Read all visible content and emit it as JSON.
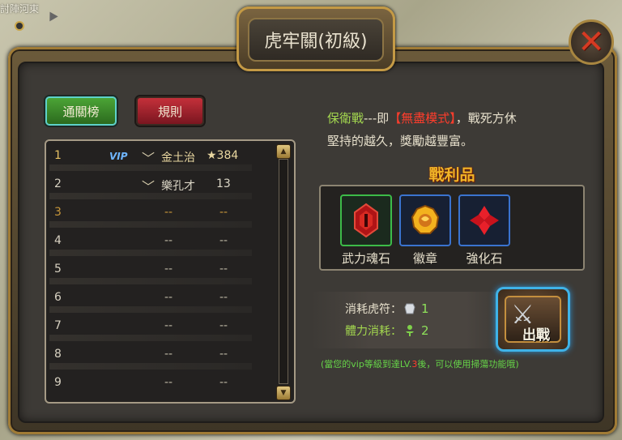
{
  "map": {
    "label": "討陣河東"
  },
  "title": "虎牢關(初級)",
  "tabs": {
    "ranking": "通關榜",
    "rules": "規則"
  },
  "ranking": [
    {
      "rank": "1",
      "vip": "VIP",
      "name": "金土治",
      "score": "★384"
    },
    {
      "rank": "2",
      "vip": "",
      "name": "樂孔才",
      "score": "13"
    },
    {
      "rank": "3",
      "name": "--",
      "score": "--"
    },
    {
      "rank": "4",
      "name": "--",
      "score": "--"
    },
    {
      "rank": "5",
      "name": "--",
      "score": "--"
    },
    {
      "rank": "6",
      "name": "--",
      "score": "--"
    },
    {
      "rank": "7",
      "name": "--",
      "score": "--"
    },
    {
      "rank": "8",
      "name": "--",
      "score": "--"
    },
    {
      "rank": "9",
      "name": "--",
      "score": "--"
    }
  ],
  "description": {
    "mode": "保衛戰",
    "sep": "---即",
    "tag": "【無盡模式】",
    "line1_rest": "，戰死方休",
    "line2": "堅持的越久，獎勵越豐富。"
  },
  "rewards_title": "戰利品",
  "rewards": [
    {
      "label": "武力魂石",
      "icon": "red-gem-icon",
      "border": "#3cbb48"
    },
    {
      "label": "徽章",
      "icon": "badge-icon",
      "border": "#3a73cf"
    },
    {
      "label": "強化石",
      "icon": "enhance-stone-icon",
      "border": "#3a73cf"
    }
  ],
  "cost": {
    "tiger_label": "消耗虎符：",
    "tiger_value": "1",
    "stamina_label": "體力消耗：",
    "stamina_value": "2"
  },
  "battle_button": "出戰",
  "vip_note": {
    "before": "(當您的vip等級到達LV.",
    "level": "3",
    "after": "後，可以使用掃蕩功能哦)"
  }
}
